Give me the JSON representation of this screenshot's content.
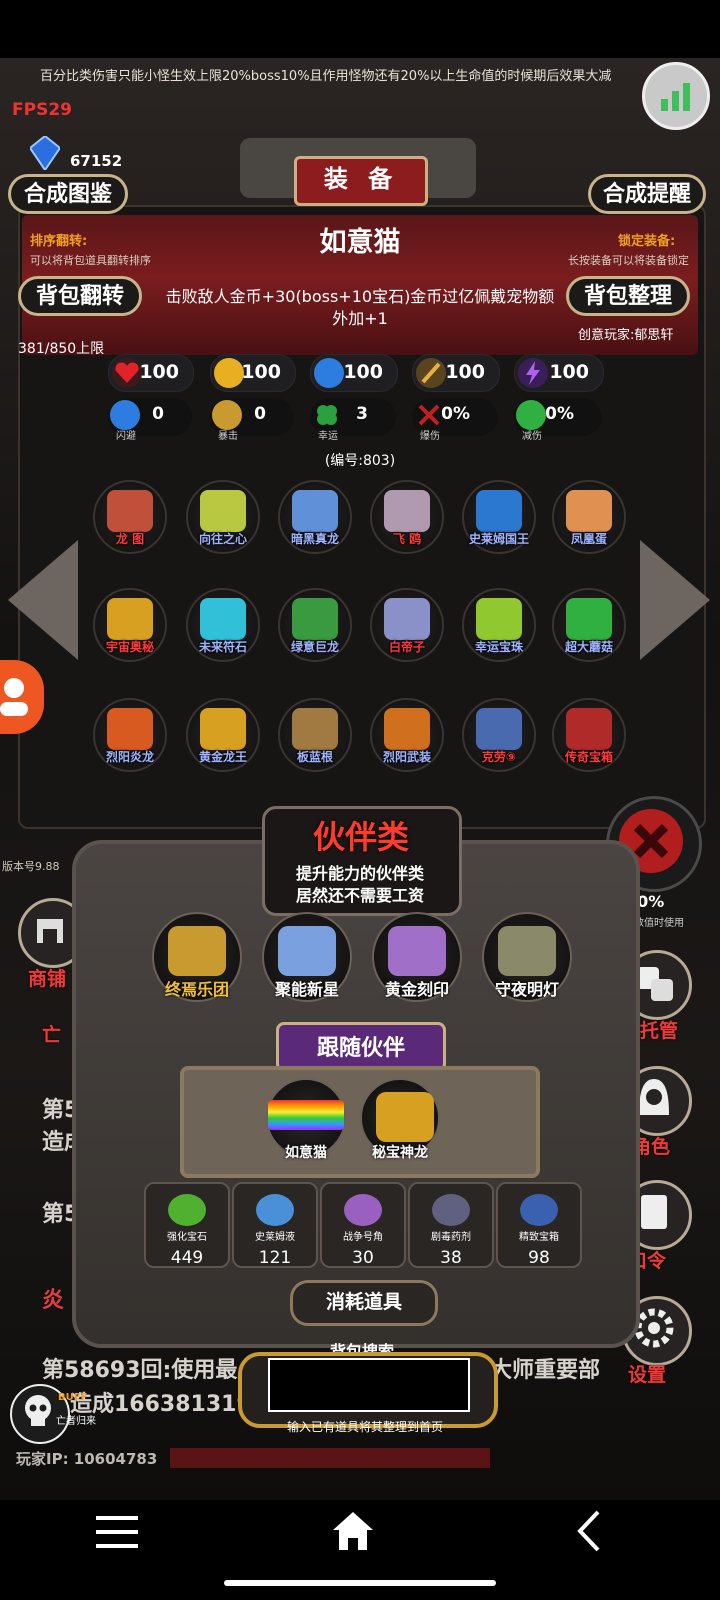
{
  "top_note": "百分比类伤害只能小怪生效上限20%boss10%且作用怪物还有20%以上生命值的时候期后效果大减",
  "fps": "FPS29",
  "currency": {
    "icon": "blue-gem-icon",
    "value": "67152"
  },
  "equipment": {
    "title": "装 备",
    "btn_atlas": "合成图鉴",
    "btn_reminder": "合成提醒",
    "sort_flip_label": "排序翻转:",
    "sort_flip_hint": "可以将背包道具翻转排序",
    "lock_label": "锁定装备:",
    "lock_hint": "长按装备可以将装备锁定",
    "btn_flip": "背包翻转",
    "btn_organize": "背包整理",
    "pet_name": "如意猫",
    "pet_desc": "击败敌人金币+30(boss+10宝石)金币过亿佩戴宠物额外加+1",
    "creator": "创意玩家:郁思轩",
    "capacity": "381/850上限",
    "stats_primary": [
      {
        "icon": "heart-icon",
        "value": "100",
        "color": "#e0232a"
      },
      {
        "icon": "strength-icon",
        "value": "100",
        "color": "#e8b020"
      },
      {
        "icon": "armor-icon",
        "value": "100",
        "color": "#2d7de0"
      },
      {
        "icon": "sword-icon",
        "value": "100",
        "color": "#d8a030"
      },
      {
        "icon": "lightning-icon",
        "value": "100",
        "color": "#8a40d0"
      }
    ],
    "stats_secondary": [
      {
        "icon": "boot-icon",
        "label": "闪避",
        "value": "0",
        "color": "#2d7de0"
      },
      {
        "icon": "crit-icon",
        "label": "暴击",
        "value": "0",
        "color": "#c89a30"
      },
      {
        "icon": "clover-icon",
        "label": "幸运",
        "value": "3",
        "color": "#2aa040"
      },
      {
        "icon": "crossed-swords-icon",
        "label": "爆伤",
        "value": "0%",
        "color": "#c02020"
      },
      {
        "icon": "shield-icon",
        "label": "减伤",
        "value": "0%",
        "color": "#30b040"
      }
    ],
    "serial": "(编号:803)",
    "grid": [
      {
        "name": "龙 图",
        "color": "#c0503a",
        "name_color": "#ff3b3b"
      },
      {
        "name": "向往之心",
        "color": "#b8c840",
        "name_color": "#9fb4ff"
      },
      {
        "name": "暗黑真龙",
        "color": "#6090d8",
        "name_color": "#9fb4ff"
      },
      {
        "name": "飞 鸥",
        "color": "#b09ab0",
        "name_color": "#ff3b3b"
      },
      {
        "name": "史莱姆国王",
        "color": "#2a78d0",
        "name_color": "#9fb4ff"
      },
      {
        "name": "凤凰蛋",
        "color": "#e09050",
        "name_color": "#9fb4ff"
      },
      {
        "name": "宇宙奥秘",
        "color": "#d8a020",
        "name_color": "#ff3b3b"
      },
      {
        "name": "未来符石",
        "color": "#30c0d8",
        "name_color": "#9fb4ff"
      },
      {
        "name": "绿意巨龙",
        "color": "#3a9a40",
        "name_color": "#9fb4ff"
      },
      {
        "name": "白帝子",
        "color": "#8a90c8",
        "name_color": "#ff3b3b"
      },
      {
        "name": "幸运宝珠",
        "color": "#90c830",
        "name_color": "#9fb4ff"
      },
      {
        "name": "超大蘑菇",
        "color": "#30b040",
        "name_color": "#9fb4ff"
      },
      {
        "name": "烈阳炎龙",
        "color": "#d85a20",
        "name_color": "#9fb4ff"
      },
      {
        "name": "黄金龙王",
        "color": "#d8a020",
        "name_color": "#9fb4ff"
      },
      {
        "name": "板蓝根",
        "color": "#a07a40",
        "name_color": "#9fb4ff"
      },
      {
        "name": "烈阳武装",
        "color": "#d0701e",
        "name_color": "#9fb4ff"
      },
      {
        "name": "克劳⑨",
        "color": "#4a6ab0",
        "name_color": "#ff3b3b"
      },
      {
        "name": "传奇宝箱",
        "color": "#b02a2a",
        "name_color": "#ff3b3b"
      }
    ]
  },
  "partner": {
    "title": "伙伴类",
    "desc_line1": "提升能力的伙伴类",
    "desc_line2": "居然还不需要工资",
    "items": [
      {
        "name": "终焉乐团",
        "color": "#c89a30",
        "name_color": "#f0c040"
      },
      {
        "name": "聚能新星",
        "color": "#7aa0e0",
        "name_color": "#ffffff"
      },
      {
        "name": "黄金刻印",
        "color": "#a070c8",
        "name_color": "#ffffff"
      },
      {
        "name": "守夜明灯",
        "color": "#8a8a6a",
        "name_color": "#ffffff"
      }
    ],
    "follow_title": "跟随伙伴",
    "follow": [
      {
        "name": "如意猫",
        "color": "#8a8a8a"
      },
      {
        "name": "秘宝神龙",
        "color": "#d8a020"
      }
    ],
    "consumables_title": "消耗道具",
    "consumables": [
      {
        "name": "强化宝石",
        "count": "449",
        "color": "#50b030"
      },
      {
        "name": "史莱姆液",
        "count": "121",
        "color": "#4a90d8"
      },
      {
        "name": "战争号角",
        "count": "30",
        "color": "#9a60c0"
      },
      {
        "name": "剧毒药剂",
        "count": "38",
        "color": "#606080"
      },
      {
        "name": "精致宝箱",
        "count": "98",
        "color": "#3a60b0"
      }
    ]
  },
  "search": {
    "title": "背包搜索",
    "hint": "输入已有道具将其整理到首页",
    "value": ""
  },
  "side": {
    "shop": "商铺",
    "left_clipped": "亡",
    "version": "版本号9.88",
    "percent": "30%",
    "percent_note": "其数值时使用",
    "manage": "托管",
    "role": "角色",
    "code": "口令",
    "settings": "设置",
    "buff_label": "BUFF",
    "buff_name": "亡者归来"
  },
  "log": {
    "line_a": "第5",
    "line_b": "造成",
    "line_c": "第5",
    "line_d": "炎",
    "line_e": "第58693回:使用最",
    "line_e2": "大师重要部",
    "line_f": "造成166381319",
    "player_ip": "玩家IP: 10604783"
  }
}
